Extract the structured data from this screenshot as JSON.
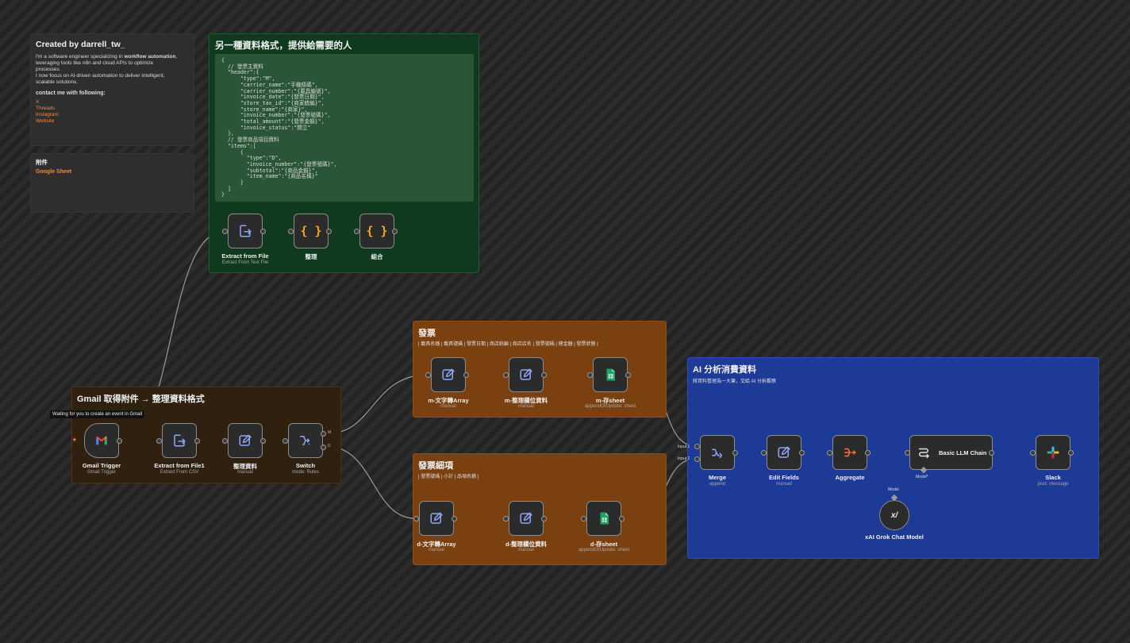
{
  "author_note": {
    "title": "Created by darrell_tw_",
    "line1_pre": "I'm a software engineer specializing in ",
    "line1_bold": "workflow automation",
    "line1_post": ",",
    "line2": "leveraging tools like n8n and cloud APIs to optimize",
    "line3": "processes.",
    "line4": "I now focus on AI-driven automation to deliver intelligent,",
    "line5": "scalable solutions.",
    "contact_heading": "contact me with following:",
    "links": [
      "X",
      "Threads",
      "Instagram",
      "Website"
    ]
  },
  "attachment_note": {
    "title": "附件",
    "link": "Google Sheet"
  },
  "format_note": {
    "title": "另一種資料格式，提供給需要的人",
    "code": "{\n  // 發票主資料\n  \"header\":{\n      \"type\":\"M\",\n      \"carrier_name\":\"手機條碼\",\n      \"carrier_number\":\"{載具編號}\",\n      \"invoice_date\":\"{發票日期}\",\n      \"store_tax_id\":\"{商家統編}\",\n      \"store_name\":\"{商家}\",\n      \"invoice_number\":\"{發票號碼}\",\n      \"total_amount\":\"{發票金額}\",\n      \"invoice_status\":\"開立\"\n  },\n  // 發票商品項目資料\n  \"items\":[\n      {\n        \"type\":\"D\",\n        \"invoice_number\":\"{發票號碼}\",\n        \"subtotal\":\"{商品金額}\",\n        \"item_name\":\"{商品名稱}\"\n      }\n  ]\n}"
  },
  "gmail_group": {
    "title": "Gmail 取得附件 → 整理資料格式"
  },
  "invoice_group": {
    "title": "發票",
    "subtitle": "| 載具名稱 | 載具號碼 | 發票日期 | 商店統編 | 商店店名 | 發票號碼 | 總金額 | 發票狀態 |"
  },
  "detail_group": {
    "title": "發票細項",
    "subtitle": "| 發票號碼 | 小計 | 品項名稱 |"
  },
  "ai_group": {
    "title": "AI 分析消費資料",
    "subtitle": "將資料整理為一大筆，交給 AI 分析觀察"
  },
  "tooltip": "Waiting for you to create an event in Gmail",
  "nodes": {
    "extract_file": {
      "label": "Extract from File",
      "sub": "Extract From Text File"
    },
    "organize": {
      "label": "整理"
    },
    "combine": {
      "label": "組合"
    },
    "gmail_trigger": {
      "label": "Gmail Trigger",
      "sub": "Gmail Trigger"
    },
    "extract_file1": {
      "label": "Extract from File1",
      "sub": "Extract From CSV"
    },
    "organize_data": {
      "label": "整理資料",
      "sub": "manual"
    },
    "switch": {
      "label": "Switch",
      "sub": "mode: Rules",
      "out0": "M",
      "out1": "D"
    },
    "m_array": {
      "label": "m-文字轉Array",
      "sub": "manual"
    },
    "m_fields": {
      "label": "m-整理欄位資料",
      "sub": "manual"
    },
    "m_sheet": {
      "label": "m-存sheet",
      "sub": "appendOrUpdate: sheet"
    },
    "d_array": {
      "label": "d-文字轉Array",
      "sub": "manual"
    },
    "d_fields": {
      "label": "d-整理欄位資料",
      "sub": "manual"
    },
    "d_sheet": {
      "label": "d-存sheet",
      "sub": "appendOrUpdate: sheet"
    },
    "merge": {
      "label": "Merge",
      "sub": "append",
      "input1": "Input 1",
      "input2": "Input 2"
    },
    "edit_fields": {
      "label": "Edit Fields",
      "sub": "manual"
    },
    "aggregate": {
      "label": "Aggregate"
    },
    "llm_chain": {
      "label": "Basic LLM Chain",
      "model_port": "Model*"
    },
    "slack": {
      "label": "Slack",
      "sub": "post: message"
    },
    "xai": {
      "label": "xAI Grok Chat Model",
      "model_port": "Model"
    }
  },
  "colors": {
    "canvas_bg": "#2a2a2a",
    "green_group": "#0f3a1d",
    "orange_group": "#7a4010",
    "dark_orange_group": "#2f2010",
    "blue_group": "#1d3a96",
    "accent_orange": "#f08a3c"
  }
}
